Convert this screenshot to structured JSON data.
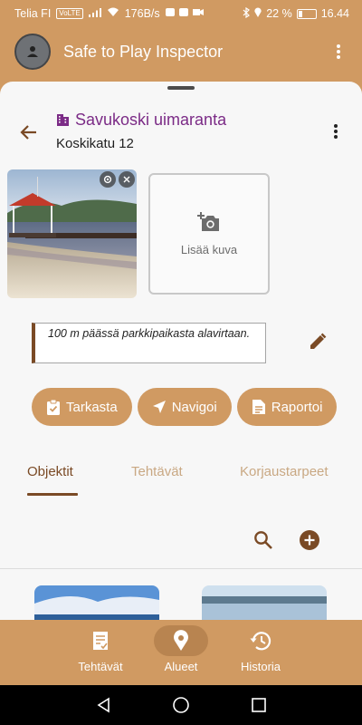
{
  "status_bar": {
    "carrier": "Telia FI",
    "carrier_badge": "VoLTE",
    "net_speed": "176B/s",
    "battery_percent": "22 %",
    "time": "16.44"
  },
  "app_bar": {
    "title": "Safe to Play Inspector"
  },
  "location": {
    "name": "Savukoski uimaranta",
    "address": "Koskikatu 12"
  },
  "photos": {
    "add_label": "Lisää kuva"
  },
  "note": {
    "text": "100 m päässä parkkipaikasta alavirtaan."
  },
  "actions": {
    "inspect": "Tarkasta",
    "navigate": "Navigoi",
    "report": "Raportoi"
  },
  "tabs": [
    {
      "label": "Objektit",
      "active": true
    },
    {
      "label": "Tehtävät",
      "active": false
    },
    {
      "label": "Korjaustarpeet",
      "active": false
    }
  ],
  "bottom_nav": [
    {
      "label": "Tehtävät",
      "icon": "task-icon",
      "active": false
    },
    {
      "label": "Alueet",
      "icon": "location-pin-icon",
      "active": true
    },
    {
      "label": "Historia",
      "icon": "history-icon",
      "active": false
    }
  ],
  "colors": {
    "brand": "#d09a62",
    "accent_dark": "#7a4a25",
    "title_purple": "#7b2b86"
  }
}
